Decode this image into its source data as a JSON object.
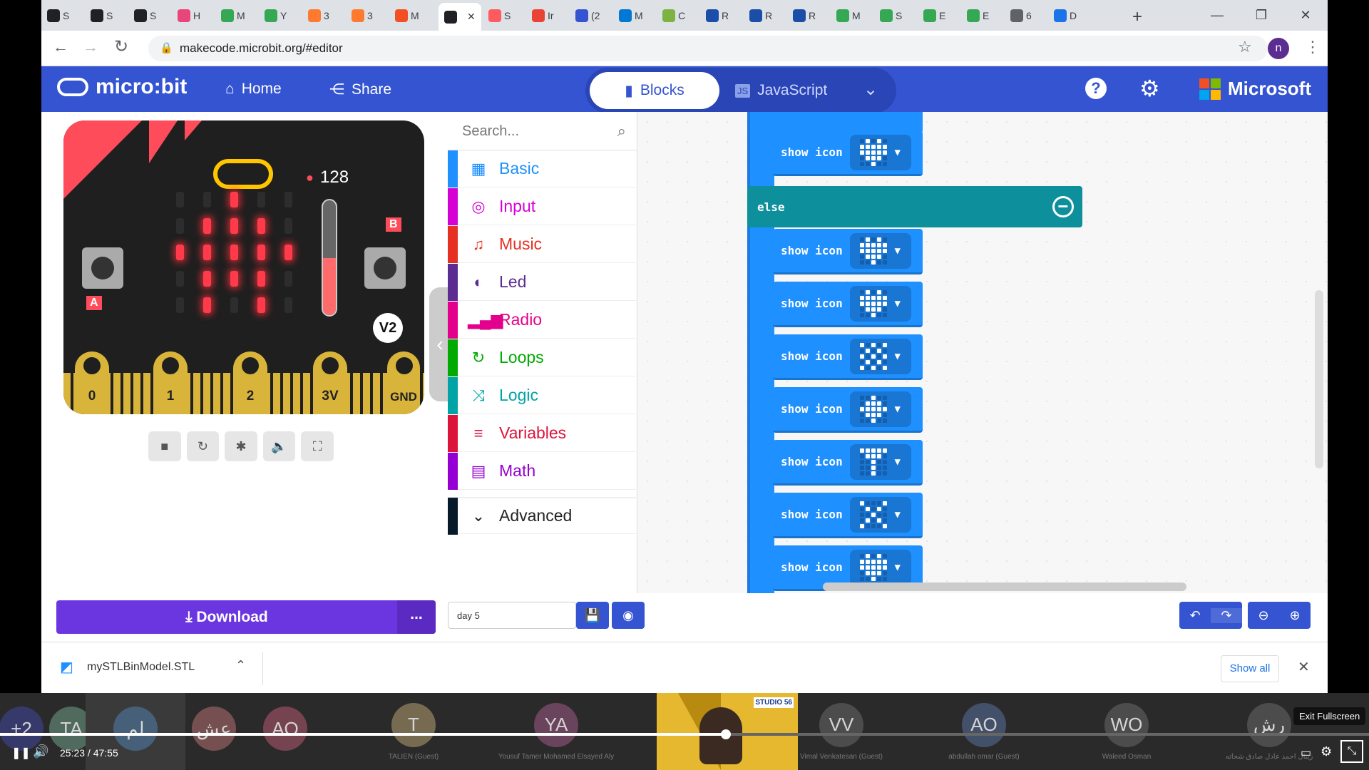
{
  "browser": {
    "tabs": [
      {
        "label": "S",
        "color": "#202124"
      },
      {
        "label": "S",
        "color": "#202124"
      },
      {
        "label": "S",
        "color": "#202124"
      },
      {
        "label": "H",
        "color": "#e8457a"
      },
      {
        "label": "M",
        "color": "#34a853"
      },
      {
        "label": "Y",
        "color": "#34a853"
      },
      {
        "label": "3",
        "color": "#ff7a2f"
      },
      {
        "label": "3",
        "color": "#ff7a2f"
      },
      {
        "label": "M",
        "color": "#f25022"
      },
      {
        "label": "",
        "color": "#202124"
      },
      {
        "label": "S",
        "color": "#ff5a5f"
      },
      {
        "label": "Ir",
        "color": "#ea4335"
      },
      {
        "label": "(2",
        "color": "#3454d1"
      },
      {
        "label": "M",
        "color": "#0078d4"
      },
      {
        "label": "C",
        "color": "#7cb342"
      },
      {
        "label": "R",
        "color": "#1a4ea8"
      },
      {
        "label": "R",
        "color": "#1a4ea8"
      },
      {
        "label": "R",
        "color": "#1a4ea8"
      },
      {
        "label": "M",
        "color": "#34a853"
      },
      {
        "label": "S",
        "color": "#34a853"
      },
      {
        "label": "E",
        "color": "#34a853"
      },
      {
        "label": "E",
        "color": "#34a853"
      },
      {
        "label": "6",
        "color": "#5f6368"
      },
      {
        "label": "D",
        "color": "#1a73e8"
      }
    ],
    "url": "makecode.microbit.org/#editor",
    "profile_initial": "n"
  },
  "header": {
    "logo": "micro:bit",
    "home": "Home",
    "share": "Share",
    "blocks": "Blocks",
    "javascript": "JavaScript",
    "brand": "Microsoft"
  },
  "simulator": {
    "sound_level": "128",
    "button_a": "A",
    "button_b": "B",
    "version": "V2",
    "pins": [
      "0",
      "1",
      "2",
      "3V",
      "GND"
    ],
    "leds": [
      [
        0,
        0,
        1,
        0,
        0
      ],
      [
        0,
        1,
        1,
        1,
        0
      ],
      [
        1,
        1,
        1,
        1,
        1
      ],
      [
        0,
        1,
        1,
        1,
        0
      ],
      [
        0,
        1,
        0,
        1,
        0
      ]
    ]
  },
  "toolbox": {
    "search_placeholder": "Search...",
    "categories": [
      {
        "label": "Basic",
        "color": "#1e90ff",
        "icon": "grid-icon"
      },
      {
        "label": "Input",
        "color": "#d400d4",
        "icon": "target-icon"
      },
      {
        "label": "Music",
        "color": "#e63022",
        "icon": "headphones-icon"
      },
      {
        "label": "Led",
        "color": "#5c2d91",
        "icon": "toggle-icon"
      },
      {
        "label": "Radio",
        "color": "#e3008c",
        "icon": "signal-icon"
      },
      {
        "label": "Loops",
        "color": "#00aa00",
        "icon": "loop-icon"
      },
      {
        "label": "Logic",
        "color": "#00a4a6",
        "icon": "shuffle-icon"
      },
      {
        "label": "Variables",
        "color": "#dc143c",
        "icon": "list-icon"
      },
      {
        "label": "Math",
        "color": "#9400d3",
        "icon": "calculator-icon"
      }
    ],
    "advanced": "Advanced"
  },
  "workspace": {
    "block_label": "show icon",
    "else_label": "else",
    "block_count": 8
  },
  "footer": {
    "download": "Download",
    "more": "...",
    "project_name": "day 5"
  },
  "downloads": {
    "file": "mySTLBinModel.STL",
    "show_all": "Show all"
  },
  "meeting": {
    "participants": [
      {
        "initials": "+2",
        "name": "",
        "color": "#3a3f7a"
      },
      {
        "initials": "TA",
        "name": "",
        "color": "#5a7a6a"
      },
      {
        "initials": "لم",
        "name": "",
        "color": "#4a6a8a"
      },
      {
        "initials": "عش",
        "name": "",
        "color": "#8a5a5a"
      },
      {
        "initials": "AO",
        "name": "",
        "color": "#8a4a5a"
      },
      {
        "initials": "T",
        "name": "TALIEN (Guest)",
        "color": "#8a7a5a"
      },
      {
        "initials": "YA",
        "name": "Yousuf Tamer Mohamed Elsayed Aly",
        "color": "#7a4a6a"
      },
      {
        "initials": "VV",
        "name": "Vimal Venkatesan (Guest)",
        "color": "#555"
      },
      {
        "initials": "AO",
        "name": "abdullah omar (Guest)",
        "color": "#4a5a7a"
      },
      {
        "initials": "WO",
        "name": "Waleed Osman",
        "color": "#555"
      },
      {
        "initials": "رش",
        "name": "زينال احمد عادل صادق شحاته",
        "color": "#555"
      }
    ],
    "presenter_logo": "STUDIO 56",
    "time": "25:23 / 47:55",
    "progress": 0.53,
    "exit_fullscreen": "Exit Fullscreen"
  }
}
